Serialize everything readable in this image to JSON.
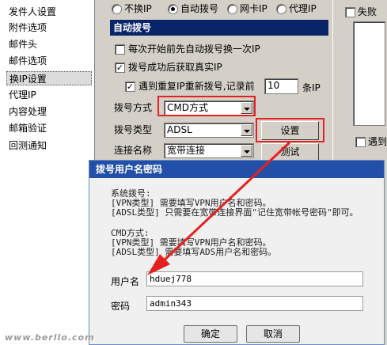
{
  "sidebar": {
    "items": [
      {
        "label": "发件人设置"
      },
      {
        "label": "附件选项"
      },
      {
        "label": "邮件头"
      },
      {
        "label": "邮件选项"
      },
      {
        "label": "换IP设置",
        "selected": true
      },
      {
        "label": "代理IP"
      },
      {
        "label": "内容处理"
      },
      {
        "label": "邮箱验证"
      },
      {
        "label": "回测通知"
      }
    ]
  },
  "ip_mode": {
    "options": [
      {
        "label": "不换IP",
        "checked": false
      },
      {
        "label": "自动拨号",
        "checked": true
      },
      {
        "label": "网卡IP",
        "checked": false
      },
      {
        "label": "代理IP",
        "checked": false
      }
    ]
  },
  "dial": {
    "section_title": "自动拨号",
    "opt1_label": "每次开始前先自动拨号换一次IP",
    "opt1_checked": false,
    "opt2_label": "拨号成功后获取真实IP",
    "opt2_checked": true,
    "opt3_label": "遇到重复IP重新拨号,记录前",
    "opt3_checked": true,
    "record_count": "10",
    "record_unit": "条IP",
    "method_label": "拨号方式",
    "method_value": "CMD方式",
    "type_label": "拨号类型",
    "type_value": "ADSL",
    "conn_label": "连接名称",
    "conn_value": "宽带连接",
    "settings_button": "设置",
    "test_button": "测试"
  },
  "right": {
    "fail_label": "失败",
    "fail_checked": false,
    "encounter_label": "遇到",
    "encounter_checked": false
  },
  "dialog": {
    "title": "拨号用户名密码",
    "sys_heading": "系统拨号:",
    "sys_line1": "[VPN类型] 需要填写VPN用户名和密码。",
    "sys_line2": "[ADSL类型] 只需要在宽带连接界面\"记住宽带帐号密码\"即可。",
    "cmd_heading": "CMD方式:",
    "cmd_line1": "[VPN类型] 需要填写VPN用户名和密码。",
    "cmd_line2": "[ADSL类型] 需要填写ADS用户名和密码。",
    "username_label": "用户名",
    "username_value": "hduej778",
    "password_label": "密码",
    "password_value": "admin343",
    "ok_button": "确定",
    "cancel_button": "取消"
  },
  "watermark": "www.berllo.com",
  "colors": {
    "highlight_box": "#e62020",
    "arrow": "#e62020",
    "title_bar": "#2250a8"
  }
}
